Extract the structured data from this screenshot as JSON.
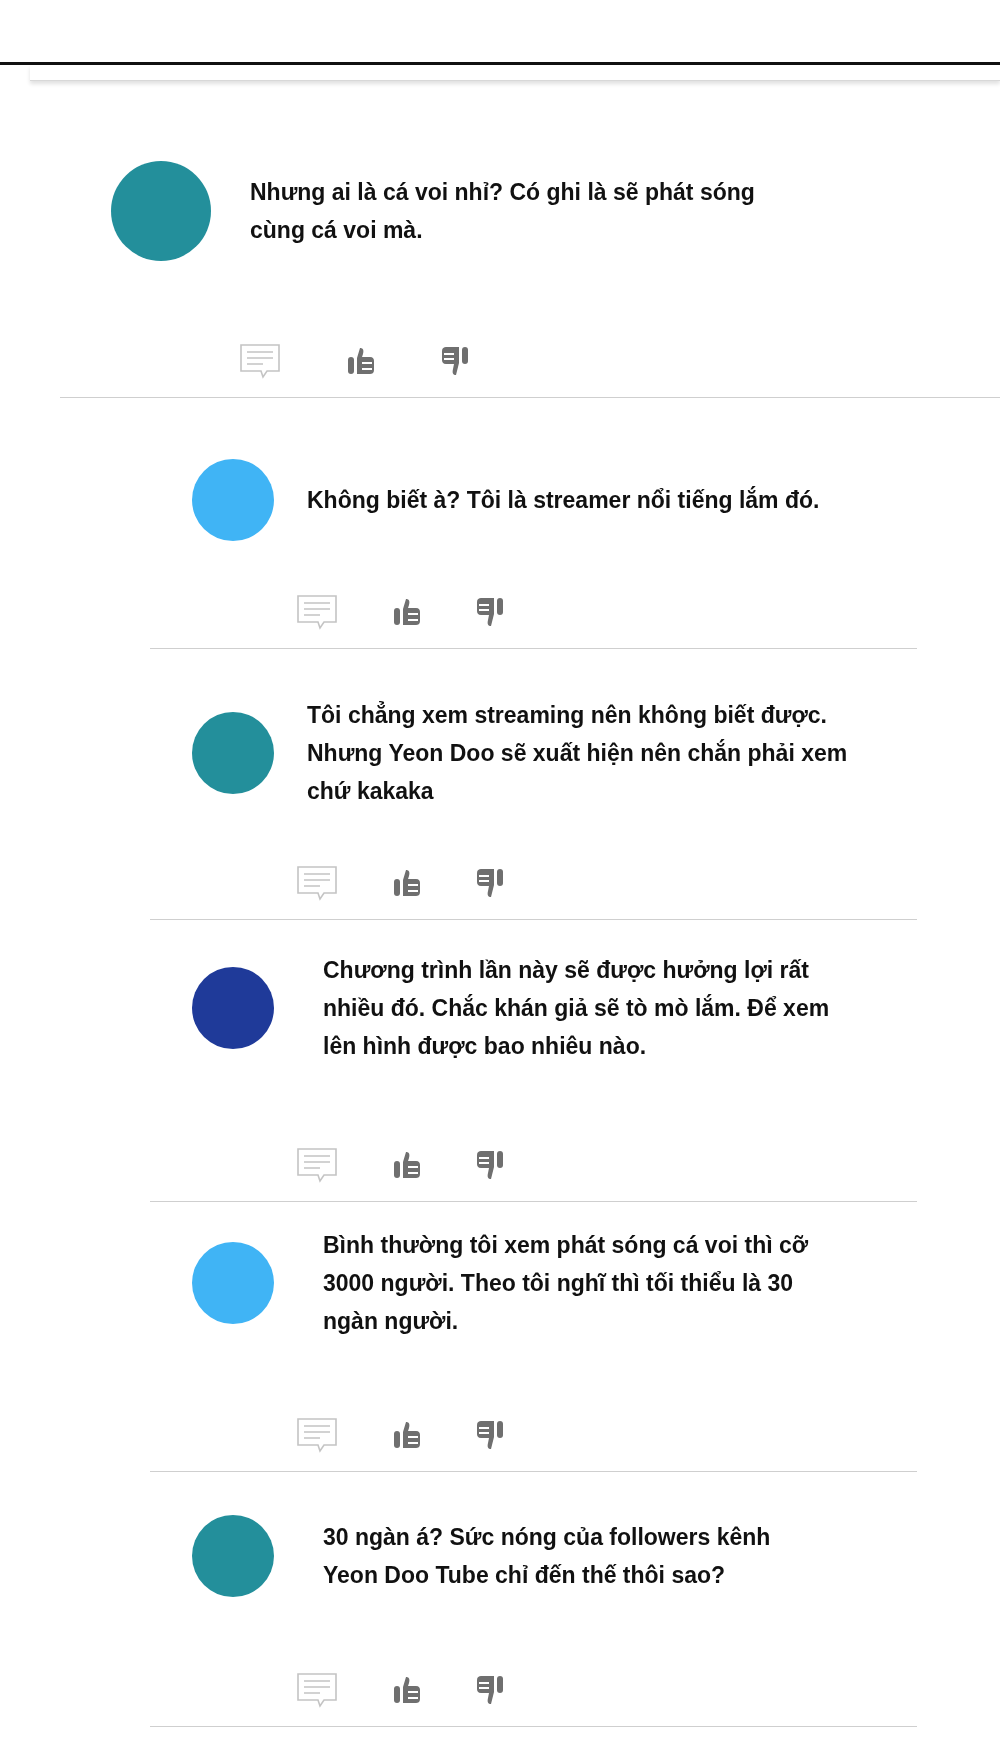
{
  "comments": [
    {
      "color": "#238f9b",
      "text": "Nhưng ai là cá voi nhỉ? Có ghi là sẽ phát sóng cùng cá voi mà.",
      "replies": [
        {
          "color": "#40b4f5",
          "text": "Không biết à? Tôi là streamer nổi tiếng lắm đó."
        },
        {
          "color": "#238f9b",
          "text": "Tôi chẳng xem streaming nên không biết được. Nhưng Yeon Doo sẽ xuất hiện nên chắn phải xem chứ kakaka"
        },
        {
          "color": "#1f3a99",
          "text": "Chương trình lần này sẽ được hưởng lợi rất nhiều đó. Chắc khán giả sẽ tò mò lắm. Để xem lên hình được bao nhiêu nào."
        },
        {
          "color": "#40b4f5",
          "text": "Bình thường tôi xem phát sóng cá voi thì cỡ 3000 người. Theo tôi nghĩ thì tối thiểu là 30 ngàn người."
        },
        {
          "color": "#238f9b",
          "text": "30 ngàn á? Sức nóng của followers kênh Yeon Doo Tube chỉ đến thế thôi sao?"
        }
      ]
    }
  ]
}
